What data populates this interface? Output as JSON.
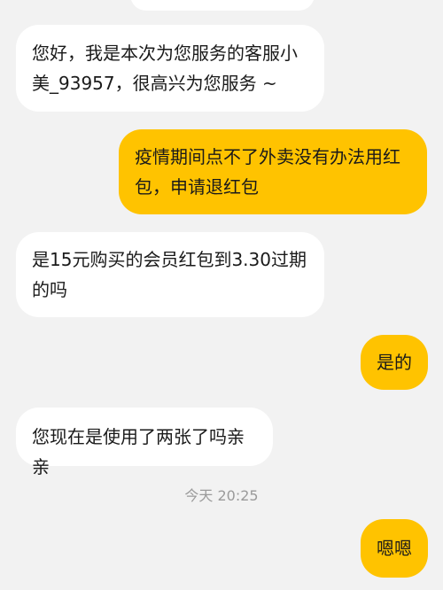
{
  "chat": {
    "messages": [
      {
        "side": "left",
        "text": "您好，我是本次为您服务的客服小美_93957，很高兴为您服务 ~"
      },
      {
        "side": "right",
        "text": "疫情期间点不了外卖没有办法用红包，申请退红包"
      },
      {
        "side": "left",
        "text": "是15元购买的会员红包到3.30过期的吗"
      },
      {
        "side": "right",
        "text": "是的"
      },
      {
        "side": "left",
        "text": "您现在是使用了两张了吗亲亲"
      },
      {
        "side": "right",
        "text": "嗯嗯"
      }
    ],
    "timestamp": "今天 20:25"
  },
  "colors": {
    "background": "#f2f2f2",
    "incoming_bubble": "#ffffff",
    "outgoing_bubble": "#ffc300"
  }
}
